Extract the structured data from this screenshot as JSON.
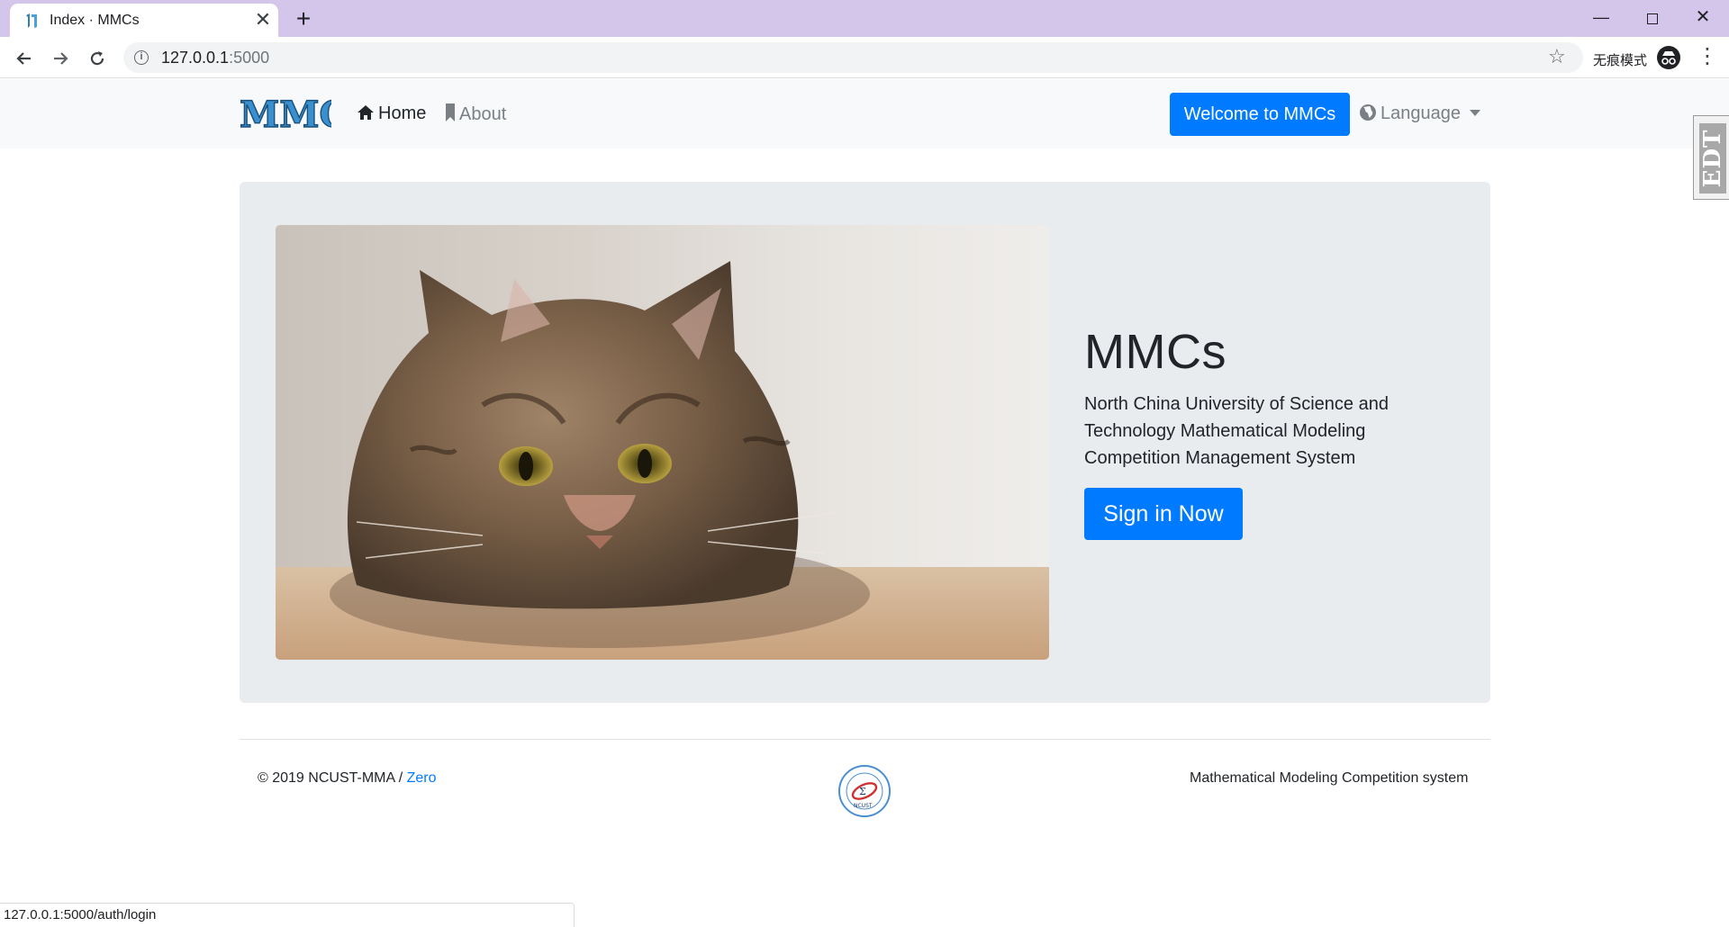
{
  "browser": {
    "tab_title": "Index · MMCs",
    "tab_close": "✕",
    "new_tab": "+",
    "url_host": "127.0.0.1",
    "url_port": ":5000",
    "incognito_label": "无痕模式",
    "status_url": "127.0.0.1:5000/auth/login"
  },
  "navbar": {
    "brand": "MMCs",
    "home_label": "Home",
    "about_label": "About",
    "welcome_button": "Welcome to MMCs",
    "language_label": "Language"
  },
  "side_widget": {
    "label": "EDT"
  },
  "hero": {
    "title": "MMCs",
    "description": "North China University of Science and Technology Mathematical Modeling Competition Management System",
    "signin_button": "Sign in Now"
  },
  "footer": {
    "copyright": "© 2019 NCUST-MMA / ",
    "author_link": "Zero",
    "logo_text": "NCUST",
    "tagline": "Mathematical Modeling Competition system"
  },
  "colors": {
    "primary": "#007bff",
    "tab_strip": "#d4c5ea",
    "navbar_bg": "#f8f9fa",
    "jumbotron_bg": "#e9ecef"
  },
  "icons": [
    "favicon-icon",
    "close-icon",
    "plus-icon",
    "minimize-icon",
    "maximize-icon",
    "back-arrow-icon",
    "forward-arrow-icon",
    "reload-icon",
    "info-icon",
    "star-icon",
    "incognito-icon",
    "kebab-menu-icon",
    "home-icon",
    "bookmark-icon",
    "globe-icon",
    "chevron-down-icon"
  ]
}
